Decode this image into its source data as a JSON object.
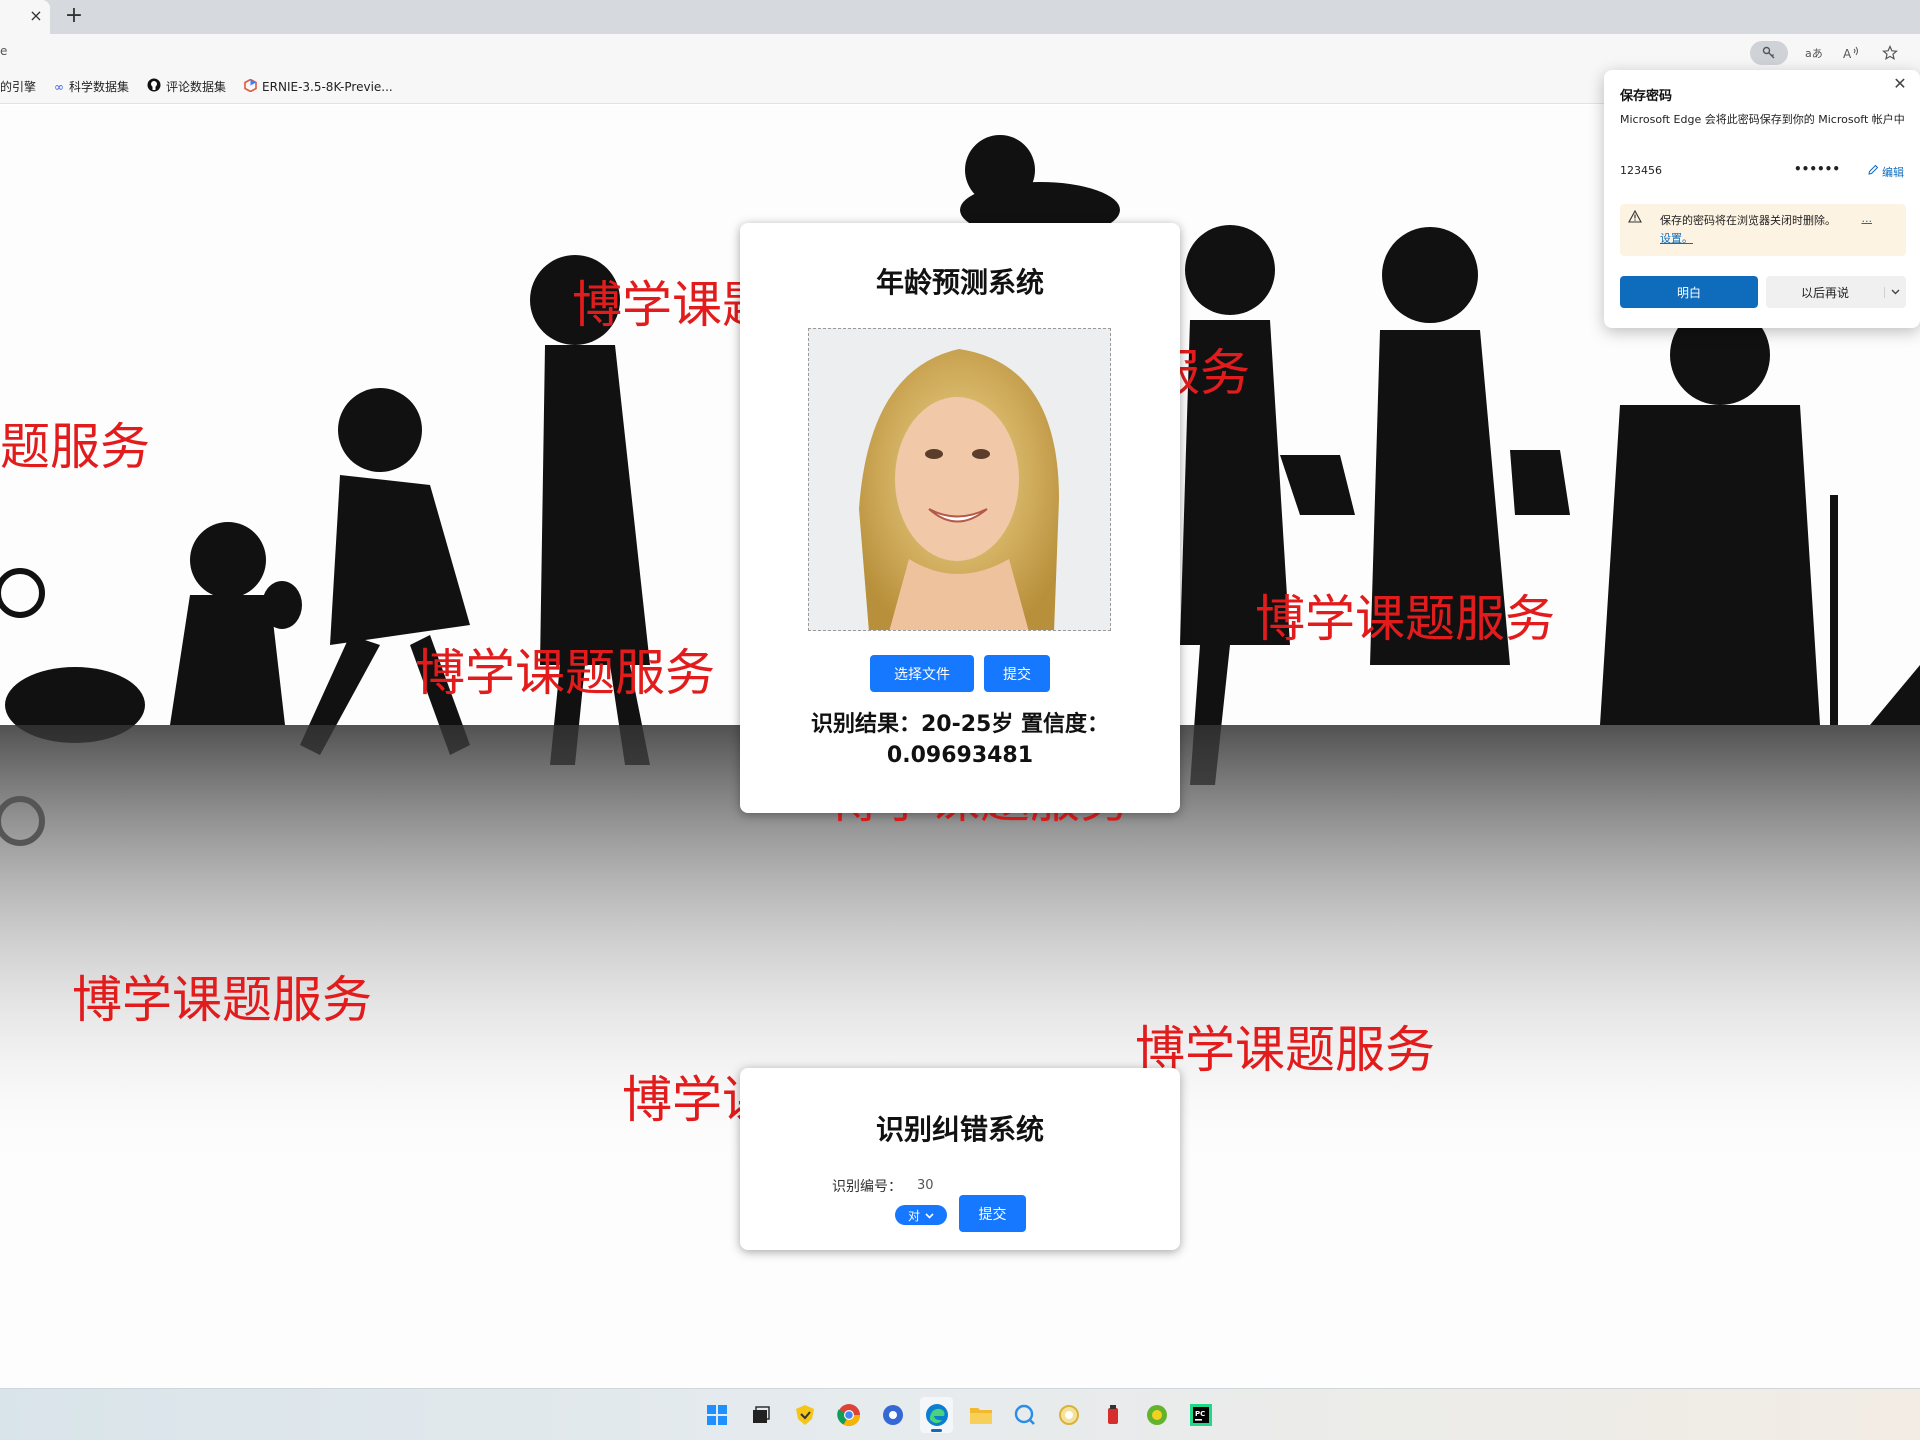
{
  "browser": {
    "tab": {
      "close_glyph": "×"
    },
    "new_tab_glyph": "+",
    "address_fragment": "e",
    "toolbar_icons": [
      "key-icon",
      "read-aloud-icon",
      "immersive-reader-icon",
      "favorite-star-icon"
    ],
    "bookmarks": [
      {
        "label": "的引擎",
        "icon": "search-bookmark-icon"
      },
      {
        "label": "科学数据集",
        "icon": "infinity-icon"
      },
      {
        "label": "评论数据集",
        "icon": "github-icon"
      },
      {
        "label": "ERNIE-3.5-8K-Previe...",
        "icon": "ernie-icon"
      }
    ]
  },
  "age_card": {
    "title": "年龄预测系统",
    "choose_file_label": "选择文件",
    "submit_label": "提交",
    "result_line1": "识别结果：20-25岁 置信度：",
    "result_line2": "0.09693481"
  },
  "correction_card": {
    "title": "识别纠错系统",
    "id_label": "识别编号：",
    "id_value": "30",
    "select_value": "对",
    "submit_label": "提交"
  },
  "watermarks": [
    "博学课题服务",
    "博学课题服务",
    "题服务",
    "博学课题服务",
    "博学课题服务",
    "博学课题服务",
    "博学课题服务",
    "博学课题服务",
    "博学课题服务"
  ],
  "password_popup": {
    "title": "保存密码",
    "close_glyph": "✕",
    "description": "Microsoft Edge 会将此密码保存到你的 Microsoft 帐户中",
    "username": "123456",
    "password_mask": "••••••",
    "edit_label": "编辑",
    "warning_text": "保存的密码将在浏览器关闭时删除。",
    "warning_more": "...",
    "warning_link": "设置。",
    "primary_button": "明白",
    "secondary_button": "以后再说"
  },
  "taskbar": {
    "icons": [
      "windows-start-icon",
      "task-view-icon",
      "security-shield-icon",
      "chrome-icon",
      "browser-circle-icon",
      "edge-icon",
      "file-explorer-icon",
      "chat-search-icon",
      "weather-icon",
      "red-app-icon",
      "green-app-icon",
      "pycharm-icon"
    ],
    "active_icon": "edge-icon"
  }
}
